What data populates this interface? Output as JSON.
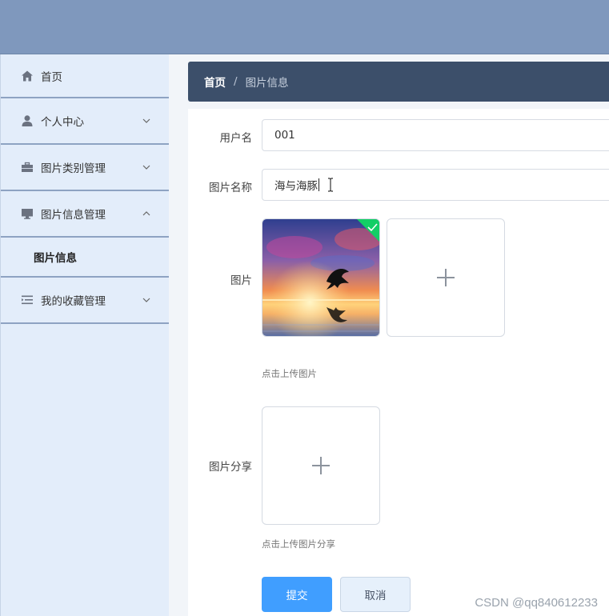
{
  "sidebar": {
    "items": [
      {
        "label": "首页",
        "icon": "home-icon"
      },
      {
        "label": "个人中心",
        "icon": "user-icon"
      },
      {
        "label": "图片类别管理",
        "icon": "briefcase-icon"
      },
      {
        "label": "图片信息管理",
        "icon": "monitor-icon"
      },
      {
        "label": "我的收藏管理",
        "icon": "list-icon"
      }
    ],
    "submenu": {
      "label": "图片信息"
    }
  },
  "breadcrumb": {
    "home": "首页",
    "separator": "/",
    "current": "图片信息"
  },
  "form": {
    "username": {
      "label": "用户名",
      "value": "001"
    },
    "image_name": {
      "label": "图片名称",
      "value": "海与海豚"
    },
    "image": {
      "label": "图片",
      "tip": "点击上传图片"
    },
    "image_share": {
      "label": "图片分享",
      "tip": "点击上传图片分享"
    },
    "submit_label": "提交",
    "cancel_label": "取消"
  },
  "watermark": "CSDN @qq840612233",
  "colors": {
    "topbar": "#7f98bd",
    "sidebar": "#e3edfa",
    "breadcrumb": "#3c4f6a",
    "primary": "#409eff",
    "success": "#13ce66"
  }
}
